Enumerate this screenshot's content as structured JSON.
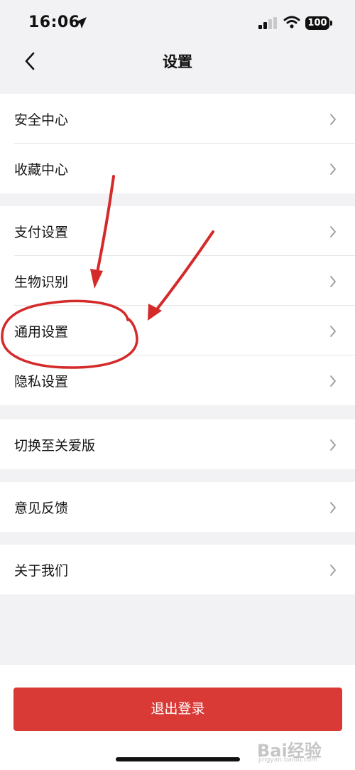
{
  "status_bar": {
    "time": "16:06",
    "battery": "100",
    "icons": [
      "location-arrow-icon",
      "cellular-signal-icon",
      "wifi-icon",
      "battery-icon"
    ]
  },
  "nav": {
    "title": "设置",
    "back_icon": "chevron-left-icon"
  },
  "groups": [
    {
      "items": [
        {
          "label": "安全中心"
        },
        {
          "label": "收藏中心"
        }
      ]
    },
    {
      "items": [
        {
          "label": "支付设置"
        },
        {
          "label": "生物识别"
        },
        {
          "label": "通用设置"
        },
        {
          "label": "隐私设置"
        }
      ]
    },
    {
      "items": [
        {
          "label": "切换至关爱版"
        }
      ]
    },
    {
      "items": [
        {
          "label": "意见反馈"
        }
      ]
    },
    {
      "items": [
        {
          "label": "关于我们"
        }
      ]
    }
  ],
  "logout": {
    "label": "退出登录"
  },
  "watermark": {
    "text": "Bai经验",
    "sub": "jingyan.baidu.com"
  },
  "colors": {
    "background": "#f2f2f4",
    "row_background": "#ffffff",
    "logout_button": "#d93a36",
    "annotation_red": "#d42a2a"
  }
}
